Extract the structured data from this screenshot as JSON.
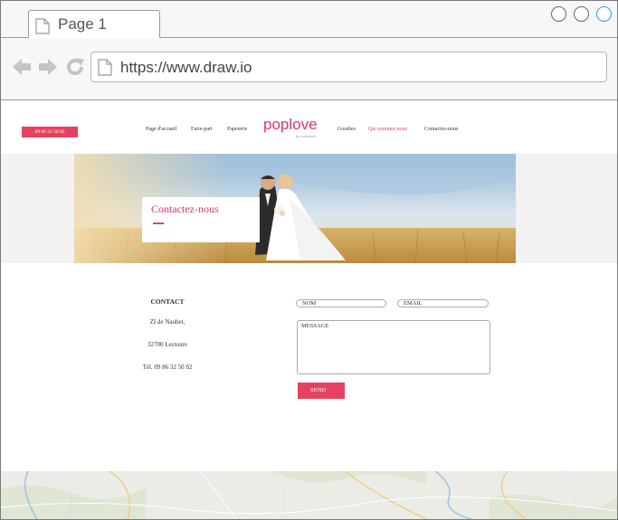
{
  "browser": {
    "tab_label": "Page 1",
    "url": "https://www.draw.io"
  },
  "site": {
    "phone_badge": "09 86 32 50 82",
    "menu": [
      {
        "label": "Page d'accueil",
        "active": false
      },
      {
        "label": "Faire-part",
        "active": false
      },
      {
        "label": "Papeterie",
        "active": false
      },
      {
        "label": "Goodies",
        "active": false
      },
      {
        "label": "Qui sommes nous",
        "active": true
      },
      {
        "label": "Contactez-nous",
        "active": false
      }
    ],
    "logo": {
      "main": "poplove",
      "sub": "by Ivoiresoft"
    },
    "accent_color": "#e8415f"
  },
  "hero": {
    "title": "Contactez-nous"
  },
  "contact": {
    "heading": "CONTACT",
    "address_line1": "ZI de Naubet,",
    "address_line2": "32700   Lectoure",
    "phone": "Tél. 09 86 32 50 82"
  },
  "form": {
    "name_placeholder": "NOM",
    "email_placeholder": "EMAIL",
    "message_placeholder": "MESSAGE",
    "send_label": "SEND"
  }
}
